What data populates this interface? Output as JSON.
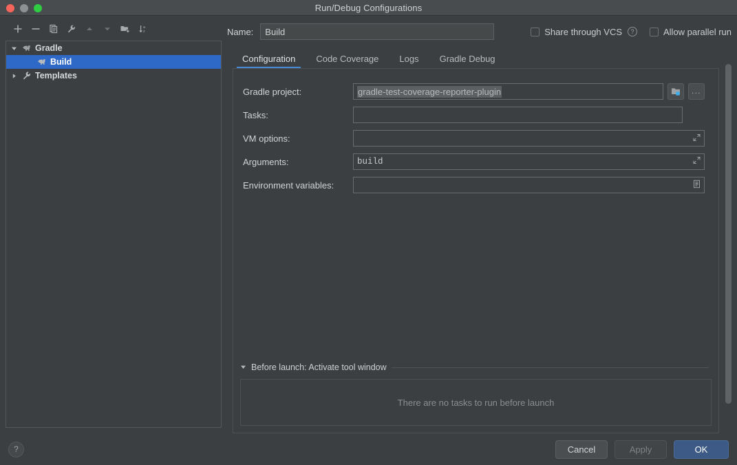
{
  "window": {
    "title": "Run/Debug Configurations",
    "traffic_lights": [
      "close-red",
      "minimize-grey",
      "zoom-green"
    ]
  },
  "sidebar": {
    "toolbar": [
      {
        "name": "add",
        "icon": "plus-icon"
      },
      {
        "name": "remove",
        "icon": "minus-icon"
      },
      {
        "name": "copy",
        "icon": "copy-icon"
      },
      {
        "name": "edit-templates",
        "icon": "wrench-icon"
      },
      {
        "name": "move-up",
        "icon": "arrow-up-icon"
      },
      {
        "name": "move-down",
        "icon": "arrow-down-icon"
      },
      {
        "name": "move-into-folder",
        "icon": "folder-add-icon"
      },
      {
        "name": "sort-alphabetically",
        "icon": "sort-az-icon"
      }
    ],
    "tree": [
      {
        "label": "Gradle",
        "icon": "gradle-elephant-icon",
        "expanded": true,
        "has_twisty": true,
        "indent": false,
        "selected": false
      },
      {
        "label": "Build",
        "icon": "gradle-elephant-icon",
        "expanded": false,
        "has_twisty": false,
        "indent": true,
        "selected": true
      },
      {
        "label": "Templates",
        "icon": "wrench-icon",
        "expanded": false,
        "has_twisty": true,
        "indent": false,
        "selected": false
      }
    ]
  },
  "main": {
    "name_label": "Name:",
    "name_value": "Build",
    "share_through_vcs": {
      "label": "Share through VCS",
      "checked": false,
      "help_icon": "question-circle-icon"
    },
    "allow_parallel_run": {
      "label": "Allow parallel run",
      "checked": false
    },
    "tabs": [
      {
        "label": "Configuration",
        "active": true
      },
      {
        "label": "Code Coverage",
        "active": false
      },
      {
        "label": "Logs",
        "active": false
      },
      {
        "label": "Gradle Debug",
        "active": false
      }
    ],
    "fields": {
      "gradle_project": {
        "label": "Gradle project:",
        "value": "gradle-test-coverage-reporter-plugin",
        "selected_text": true,
        "buttons": [
          {
            "name": "browse-project-button",
            "icon": "folder-module-icon"
          },
          {
            "name": "more-button",
            "icon": "ellipsis-icon",
            "label": "..."
          }
        ]
      },
      "tasks": {
        "label": "Tasks:",
        "value": "",
        "placeholder": ""
      },
      "vm_options": {
        "label": "VM options:",
        "value": "",
        "placeholder": "",
        "expand_icon": "expand-diagonal-icon"
      },
      "arguments": {
        "label": "Arguments:",
        "value": "build",
        "mono": true,
        "expand_icon": "expand-diagonal-icon"
      },
      "environment_variables": {
        "label": "Environment variables:",
        "value": "",
        "placeholder": "",
        "browse_icon": "list-edit-icon"
      }
    },
    "before_launch": {
      "title": "Before launch: Activate tool window",
      "expanded": true,
      "empty_text": "There are no tasks to run before launch"
    }
  },
  "footer": {
    "help": "?",
    "cancel": "Cancel",
    "apply": "Apply",
    "apply_disabled": true,
    "ok": "OK"
  },
  "colors": {
    "window_bg": "#3c3f41",
    "titlebar_bg": "#494c4e",
    "selection_blue": "#2f69c8",
    "tab_accent": "#4a88d8",
    "primary_button": "#3c5a85",
    "text": "#d2d5d7",
    "muted_text": "#8a8e90"
  }
}
